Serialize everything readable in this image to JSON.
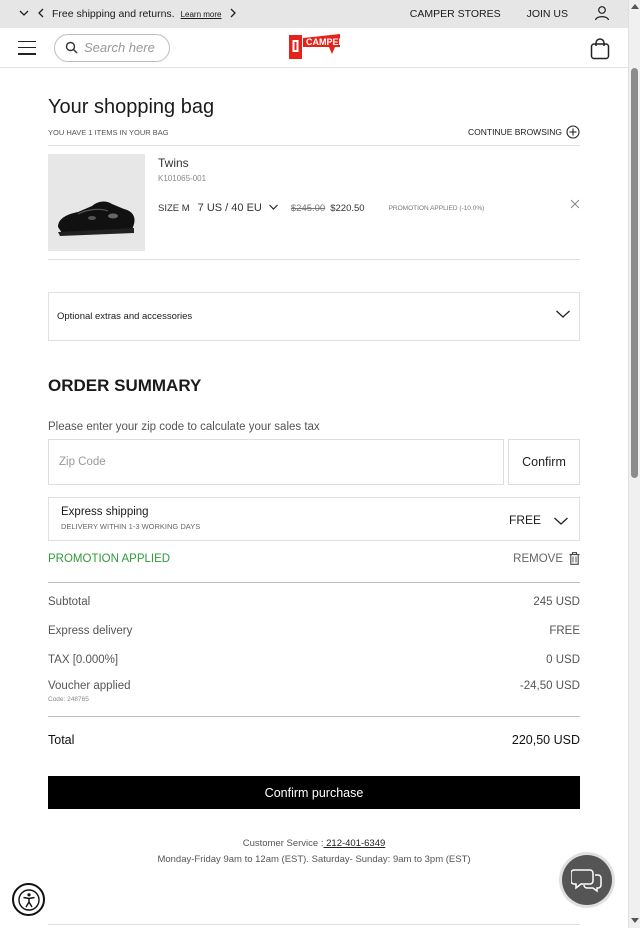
{
  "topbar": {
    "promo": "Free shipping and returns.",
    "learn_more": "Learn more",
    "stores": "CAMPER STORES",
    "join": "JOIN US"
  },
  "header": {
    "search_placeholder": "Search here",
    "logo_text": "CAMPER",
    "logo_color": "#e4231b"
  },
  "bag": {
    "title": "Your shopping bag",
    "count_text": "YOU HAVE 1 ITEMS IN YOUR BAG",
    "continue": "CONTINUE BROWSING"
  },
  "product": {
    "name": "Twins",
    "ref": "K101065-001",
    "size_label": "SIZE M",
    "size_value": "7 US / 40 EU",
    "old_price": "$245.00",
    "new_price": "$220.50",
    "promo_note": "PROMOTION APPLIED (-10.0%)"
  },
  "extras": {
    "label": "Optional extras and accessories"
  },
  "summary": {
    "title": "ORDER SUMMARY",
    "zip_label": "Please enter your zip code to calculate your sales tax",
    "zip_placeholder": "Zip Code",
    "zip_confirm": "Confirm",
    "shipping_name": "Express shipping",
    "shipping_sub": "DELIVERY WITHIN 1-3 WORKING DAYS",
    "shipping_price": "FREE",
    "promo_applied": "PROMOTION APPLIED",
    "remove": "REMOVE",
    "subtotal_label": "Subtotal",
    "subtotal_value": "245 USD",
    "delivery_label": "Express delivery",
    "delivery_value": "FREE",
    "tax_label": "TAX [0.000%]",
    "tax_value": "0 USD",
    "voucher_label": "Voucher applied",
    "voucher_code": "Code: 248765",
    "voucher_value": "-24,50 USD",
    "total_label": "Total",
    "total_value": "220,50 USD",
    "purchase": "Confirm purchase"
  },
  "customer_service": {
    "label": "Customer Service :",
    "phone": " 212-401-6349",
    "hours": "Monday-Friday 9am to 12am (EST). Saturday- Sunday: 9am to 3pm (EST)"
  },
  "colors": {
    "promo_green": "#2f9b3a",
    "primary_button": "#000000"
  }
}
